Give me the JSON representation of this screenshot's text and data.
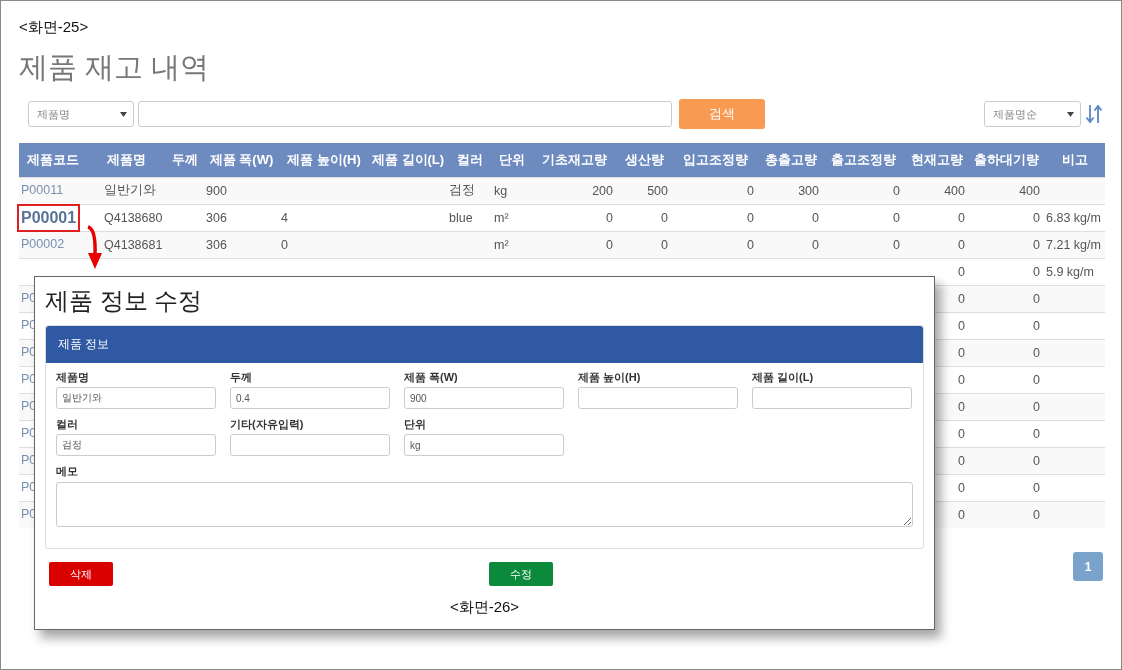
{
  "caption_top": "<화면-25>",
  "title": "제품 재고 내역",
  "filter": {
    "field": "제품명",
    "search_button": "검색",
    "sort": "제품명순"
  },
  "table": {
    "columns": [
      {
        "label": "제품코드",
        "kind": "code"
      },
      {
        "label": "제품명",
        "kind": "text"
      },
      {
        "label": "두께",
        "kind": "text"
      },
      {
        "label": "제품 폭(W)",
        "kind": "text"
      },
      {
        "label": "제품 높이(H)",
        "kind": "text"
      },
      {
        "label": "제품 길이(L)",
        "kind": "text"
      },
      {
        "label": "컬러",
        "kind": "text"
      },
      {
        "label": "단위",
        "kind": "text"
      },
      {
        "label": "기초재고량",
        "kind": "number"
      },
      {
        "label": "생산량",
        "kind": "number"
      },
      {
        "label": "입고조정량",
        "kind": "number"
      },
      {
        "label": "총출고량",
        "kind": "number"
      },
      {
        "label": "출고조정량",
        "kind": "number"
      },
      {
        "label": "현재고량",
        "kind": "number"
      },
      {
        "label": "출하대기량",
        "kind": "number"
      },
      {
        "label": "비고",
        "kind": "text"
      }
    ],
    "rows": [
      {
        "highlighted": false,
        "cells": [
          "P00011",
          "일반기와",
          null,
          "900",
          null,
          null,
          "검정",
          "kg",
          "200",
          "500",
          "0",
          "300",
          "0",
          "400",
          "400",
          null
        ]
      },
      {
        "highlighted": true,
        "cells": [
          "P00001",
          "Q4138680",
          null,
          "306",
          "4",
          null,
          "blue",
          "m²",
          "0",
          "0",
          "0",
          "0",
          "0",
          "0",
          "0",
          "6.83 kg/m"
        ]
      },
      {
        "highlighted": false,
        "cells": [
          "P00002",
          "Q4138681",
          null,
          "306",
          "0",
          null,
          null,
          "m²",
          "0",
          "0",
          "0",
          "0",
          "0",
          "0",
          "0",
          "7.21 kg/m"
        ]
      },
      {
        "highlighted": false,
        "cells": [
          null,
          null,
          null,
          null,
          null,
          null,
          null,
          null,
          null,
          null,
          null,
          null,
          null,
          "0",
          "0",
          "5.9 kg/m"
        ]
      },
      {
        "highlighted": false,
        "cells": [
          "P0",
          null,
          null,
          null,
          null,
          null,
          null,
          null,
          null,
          null,
          null,
          null,
          null,
          "0",
          "0",
          null
        ]
      },
      {
        "highlighted": false,
        "cells": [
          "P0",
          null,
          null,
          null,
          null,
          null,
          null,
          null,
          null,
          null,
          null,
          null,
          null,
          "0",
          "0",
          null
        ]
      },
      {
        "highlighted": false,
        "cells": [
          "P0",
          null,
          null,
          null,
          null,
          null,
          null,
          null,
          null,
          null,
          null,
          null,
          null,
          "0",
          "0",
          null
        ]
      },
      {
        "highlighted": false,
        "cells": [
          "P0",
          null,
          null,
          null,
          null,
          null,
          null,
          null,
          null,
          null,
          null,
          null,
          null,
          "0",
          "0",
          null
        ]
      },
      {
        "highlighted": false,
        "cells": [
          "P0",
          null,
          null,
          null,
          null,
          null,
          null,
          null,
          null,
          null,
          null,
          null,
          null,
          "0",
          "0",
          null
        ]
      },
      {
        "highlighted": false,
        "cells": [
          "P0",
          null,
          null,
          null,
          null,
          null,
          null,
          null,
          null,
          null,
          null,
          null,
          null,
          "0",
          "0",
          null
        ]
      },
      {
        "highlighted": false,
        "cells": [
          "P0",
          null,
          null,
          null,
          null,
          null,
          null,
          null,
          null,
          null,
          null,
          null,
          null,
          "0",
          "0",
          null
        ]
      },
      {
        "highlighted": false,
        "cells": [
          "P0",
          null,
          null,
          null,
          null,
          null,
          null,
          null,
          null,
          null,
          null,
          null,
          null,
          "0",
          "0",
          null
        ]
      },
      {
        "highlighted": false,
        "cells": [
          "P0",
          null,
          null,
          null,
          null,
          null,
          null,
          null,
          null,
          null,
          null,
          null,
          null,
          "0",
          "0",
          null
        ]
      }
    ]
  },
  "pagination": [
    {
      "label": "1",
      "selected": true
    }
  ],
  "dialog": {
    "title": "제품 정보 수정",
    "panel_title": "제품 정보",
    "fields": [
      {
        "label": "제품명",
        "value": "일반기와"
      },
      {
        "label": "두께",
        "value": "0.4"
      },
      {
        "label": "제품 폭(W)",
        "value": "900"
      },
      {
        "label": "제품 높이(H)"
      },
      {
        "label": "제품 길이(L)"
      },
      {
        "label": "컬러",
        "value": "검정"
      },
      {
        "label": "기타(자유입력)"
      },
      {
        "label": "단위",
        "value": "kg"
      }
    ],
    "memo_label": "메모",
    "delete_button": "삭제",
    "save_button": "수정",
    "caption": "<화면-26>"
  }
}
